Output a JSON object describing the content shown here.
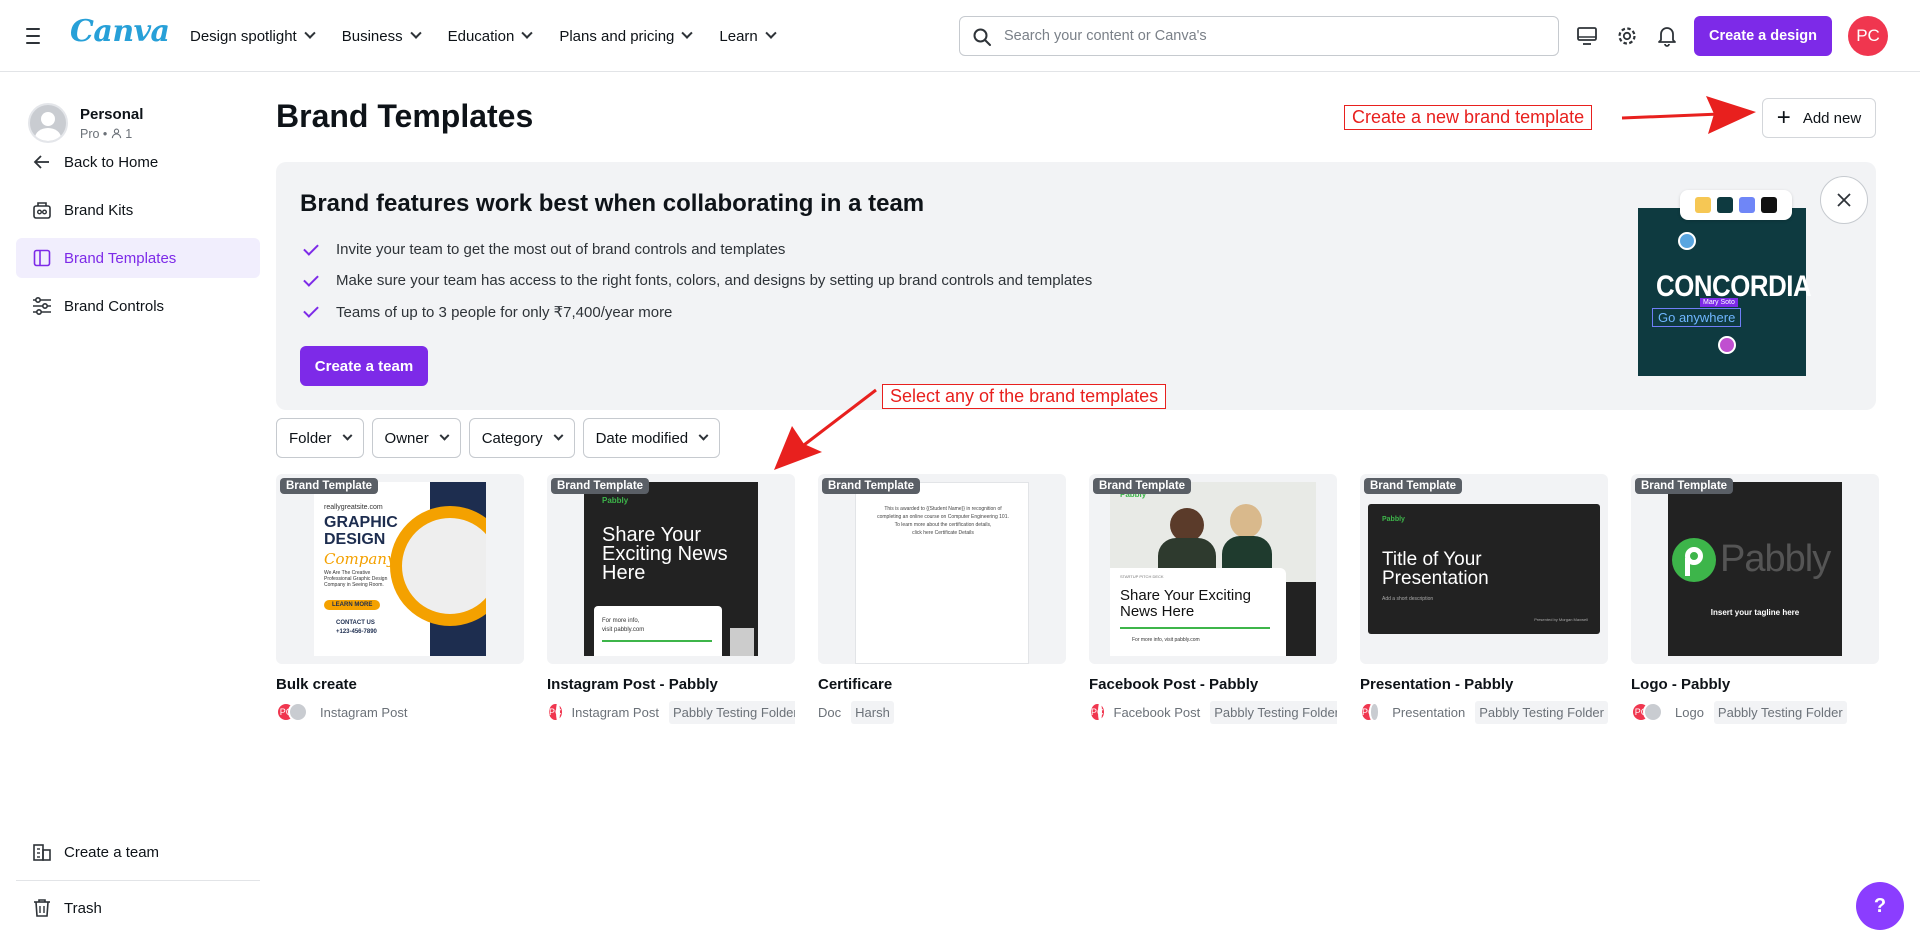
{
  "app": {
    "logo": "Canva"
  },
  "topnav": {
    "items": [
      "Design spotlight",
      "Business",
      "Education",
      "Plans and pricing",
      "Learn"
    ],
    "search_placeholder": "Search your content or Canva's",
    "create_design": "Create a design",
    "avatar_initials": "PC"
  },
  "sidebar": {
    "profile_name": "Personal",
    "profile_plan": "Pro",
    "profile_members": "1",
    "items": [
      {
        "label": "Back to Home",
        "icon": "arrow-left-icon"
      },
      {
        "label": "Brand Kits",
        "icon": "brand-kit-icon"
      },
      {
        "label": "Brand Templates",
        "icon": "template-icon",
        "active": true
      },
      {
        "label": "Brand Controls",
        "icon": "sliders-icon"
      }
    ],
    "bottom_items": [
      {
        "label": "Create a team",
        "icon": "building-icon"
      },
      {
        "label": "Trash",
        "icon": "trash-icon"
      }
    ]
  },
  "main": {
    "title": "Brand Templates",
    "add_new": "Add new",
    "annotations": {
      "add_new": "Create a new brand template",
      "templates": "Select any of the brand templates"
    },
    "banner": {
      "title": "Brand features work best when collaborating in a team",
      "bullets": [
        "Invite your team to get the most out of brand controls and templates",
        "Make sure your team has access to the right fonts, colors, and designs by setting up brand controls and templates",
        "Teams of up to 3 people for only ₹7,400/year more"
      ],
      "button": "Create a team",
      "promo_text": "CONCORDIA",
      "promo_tag": "Go anywhere",
      "promo_name": "Mary Soto",
      "swatch_colors": [
        "#f6c754",
        "#0e3a40",
        "#6f86f7",
        "#111111"
      ]
    },
    "filters": [
      "Folder",
      "Owner",
      "Category",
      "Date modified"
    ],
    "badge": "Brand Template",
    "cards": [
      {
        "title": "Bulk create",
        "type": "Instagram Post",
        "folder": "",
        "art": {
          "site": "reallygreatsite.com",
          "line1": "GRAPHIC",
          "line2": "DESIGN",
          "script": "Company",
          "body": "We Are The Creative Professional Graphic Design Company in Seeing Room.",
          "cta": "LEARN MORE",
          "contact": "CONTACT US",
          "phone": "+123-456-7890"
        }
      },
      {
        "title": "Instagram Post - Pabbly",
        "type": "Instagram Post",
        "folder": "Pabbly Testing Folder",
        "art": {
          "brand": "Pabbly",
          "headline": "Share Your Exciting News Here",
          "foot1": "For more info,",
          "foot2": "visit pabbly.com"
        }
      },
      {
        "title": "Certificare",
        "type": "Doc",
        "folder": "Harsh",
        "art": {
          "line1": "This is awarded to {{Student Name}} in recognition of",
          "line2": "completing an online course on Computer Engineering 101.",
          "line3": "To learn more about the certification details,",
          "line4": "click here Certificate Details"
        }
      },
      {
        "title": "Facebook Post - Pabbly",
        "type": "Facebook Post",
        "folder": "Pabbly Testing Folder",
        "art": {
          "brand": "Pabbly",
          "small": "STARTUP PITCH DECK",
          "headline": "Share Your Exciting News Here",
          "foot": "For more info, visit pabbly.com"
        }
      },
      {
        "title": "Presentation - Pabbly",
        "type": "Presentation",
        "folder": "Pabbly Testing Folder",
        "art": {
          "brand": "Pabbly",
          "headline": "Title of Your Presentation",
          "sub": "Add a short description",
          "powered": "Presented by Morgan Maxwell"
        }
      },
      {
        "title": "Logo - Pabbly",
        "type": "Logo",
        "folder": "Pabbly Testing Folder",
        "art": {
          "brand": "Pabbly",
          "tagline": "Insert your tagline here"
        }
      }
    ]
  },
  "help": "?"
}
